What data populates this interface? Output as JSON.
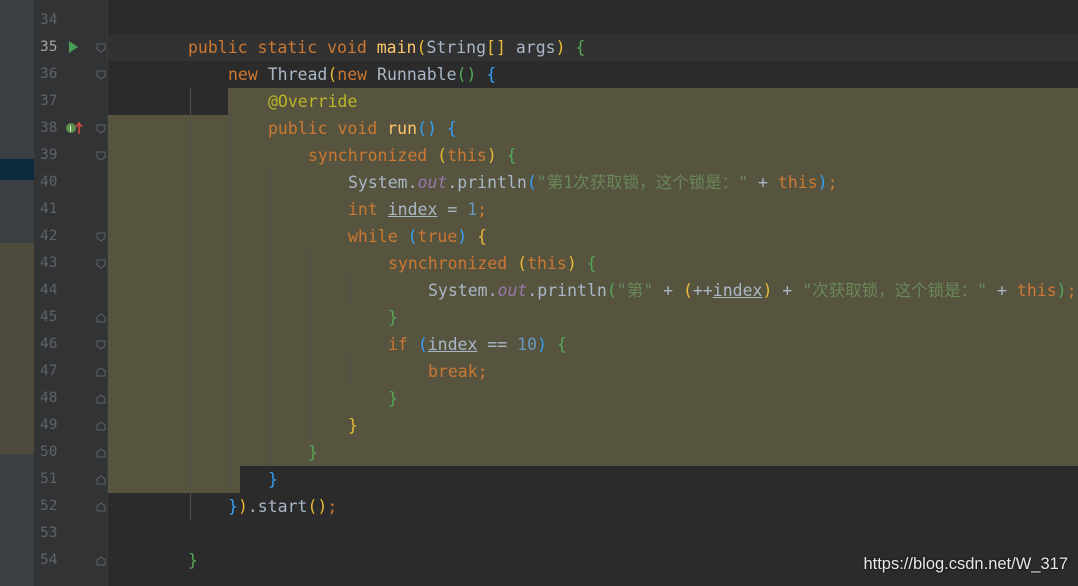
{
  "colors": {
    "background": "#2b2b2b",
    "gutter": "#313335",
    "selection": "#56543f",
    "current_line": "#323232"
  },
  "lines": [
    {
      "num": "34",
      "tokens": []
    },
    {
      "num": "35",
      "tokens": [
        {
          "t": "public static void ",
          "c": "kw"
        },
        {
          "t": "main",
          "c": "fn"
        },
        {
          "t": "(",
          "c": "p1"
        },
        {
          "t": "String",
          "c": ""
        },
        {
          "t": "[] ",
          "c": "p1"
        },
        {
          "t": "args",
          "c": ""
        },
        {
          "t": ") ",
          "c": "p1"
        },
        {
          "t": "{",
          "c": "p2"
        }
      ]
    },
    {
      "num": "36",
      "tokens": [
        {
          "t": "new ",
          "c": "kw"
        },
        {
          "t": "Thread",
          "c": ""
        },
        {
          "t": "(",
          "c": "p1"
        },
        {
          "t": "new ",
          "c": "kw"
        },
        {
          "t": "Runnable",
          "c": ""
        },
        {
          "t": "() ",
          "c": "p2"
        },
        {
          "t": "{",
          "c": "p3"
        }
      ]
    },
    {
      "num": "37",
      "tokens": [
        {
          "t": "@Override",
          "c": "ann"
        }
      ]
    },
    {
      "num": "38",
      "tokens": [
        {
          "t": "public void ",
          "c": "kw"
        },
        {
          "t": "run",
          "c": "fn"
        },
        {
          "t": "() ",
          "c": "p3"
        },
        {
          "t": "{",
          "c": "p3"
        }
      ]
    },
    {
      "num": "39",
      "tokens": [
        {
          "t": "synchronized ",
          "c": "kw"
        },
        {
          "t": "(",
          "c": "p1"
        },
        {
          "t": "this",
          "c": "kw"
        },
        {
          "t": ") ",
          "c": "p1"
        },
        {
          "t": "{",
          "c": "p2"
        }
      ]
    },
    {
      "num": "40",
      "tokens": [
        {
          "t": "System.",
          "c": ""
        },
        {
          "t": "out",
          "c": "fld"
        },
        {
          "t": ".println",
          "c": ""
        },
        {
          "t": "(",
          "c": "p3"
        },
        {
          "t": "\"第1次获取锁，这个锁是：\"",
          "c": "str"
        },
        {
          "t": " + ",
          "c": ""
        },
        {
          "t": "this",
          "c": "kw"
        },
        {
          "t": ")",
          "c": "p3"
        },
        {
          "t": ";",
          "c": "kw"
        }
      ]
    },
    {
      "num": "41",
      "tokens": [
        {
          "t": "int ",
          "c": "kw"
        },
        {
          "t": "index",
          "c": "ul"
        },
        {
          "t": " = ",
          "c": ""
        },
        {
          "t": "1",
          "c": "num"
        },
        {
          "t": ";",
          "c": "kw"
        }
      ]
    },
    {
      "num": "42",
      "tokens": [
        {
          "t": "while ",
          "c": "kw"
        },
        {
          "t": "(",
          "c": "p3"
        },
        {
          "t": "true",
          "c": "kw"
        },
        {
          "t": ") ",
          "c": "p3"
        },
        {
          "t": "{",
          "c": "p1"
        }
      ]
    },
    {
      "num": "43",
      "tokens": [
        {
          "t": "synchronized ",
          "c": "kw"
        },
        {
          "t": "(",
          "c": "p1"
        },
        {
          "t": "this",
          "c": "kw"
        },
        {
          "t": ") ",
          "c": "p1"
        },
        {
          "t": "{",
          "c": "p2"
        }
      ]
    },
    {
      "num": "44",
      "tokens": [
        {
          "t": "System.",
          "c": ""
        },
        {
          "t": "out",
          "c": "fld"
        },
        {
          "t": ".println",
          "c": ""
        },
        {
          "t": "(",
          "c": "p2"
        },
        {
          "t": "\"第\"",
          "c": "str"
        },
        {
          "t": " + ",
          "c": ""
        },
        {
          "t": "(",
          "c": "p1"
        },
        {
          "t": "++",
          "c": ""
        },
        {
          "t": "index",
          "c": "ul"
        },
        {
          "t": ")",
          "c": "p1"
        },
        {
          "t": " + ",
          "c": ""
        },
        {
          "t": "\"次获取锁，这个锁是：\"",
          "c": "str"
        },
        {
          "t": " + ",
          "c": ""
        },
        {
          "t": "this",
          "c": "kw"
        },
        {
          "t": ")",
          "c": "p2"
        },
        {
          "t": ";",
          "c": "kw"
        }
      ]
    },
    {
      "num": "45",
      "tokens": [
        {
          "t": "}",
          "c": "p2"
        }
      ]
    },
    {
      "num": "46",
      "tokens": [
        {
          "t": "if ",
          "c": "kw"
        },
        {
          "t": "(",
          "c": "p3"
        },
        {
          "t": "index",
          "c": "ul"
        },
        {
          "t": " == ",
          "c": ""
        },
        {
          "t": "10",
          "c": "num"
        },
        {
          "t": ") ",
          "c": "p3"
        },
        {
          "t": "{",
          "c": "p2"
        }
      ]
    },
    {
      "num": "47",
      "tokens": [
        {
          "t": "break",
          "c": "kw"
        },
        {
          "t": ";",
          "c": "kw"
        }
      ]
    },
    {
      "num": "48",
      "tokens": [
        {
          "t": "}",
          "c": "p2"
        }
      ]
    },
    {
      "num": "49",
      "tokens": [
        {
          "t": "}",
          "c": "p1"
        }
      ]
    },
    {
      "num": "50",
      "tokens": [
        {
          "t": "}",
          "c": "p2"
        }
      ]
    },
    {
      "num": "51",
      "tokens": [
        {
          "t": "}",
          "c": "p3"
        }
      ]
    },
    {
      "num": "52",
      "tokens": [
        {
          "t": "}",
          "c": "p3"
        },
        {
          "t": ")",
          "c": "p1"
        },
        {
          "t": ".start",
          "c": ""
        },
        {
          "t": "()",
          "c": "p1"
        },
        {
          "t": ";",
          "c": "kw"
        }
      ]
    },
    {
      "num": "53",
      "tokens": []
    },
    {
      "num": "54",
      "tokens": [
        {
          "t": "}",
          "c": "p2"
        }
      ]
    }
  ],
  "watermark": "https://blog.csdn.net/W_317"
}
